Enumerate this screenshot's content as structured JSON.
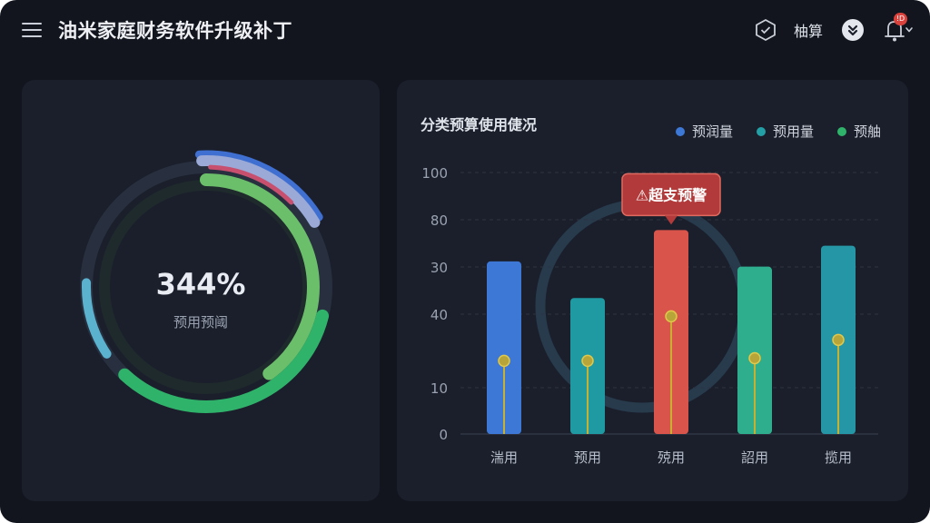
{
  "header": {
    "title": "油米家庭财务软件升级补丁",
    "budget_label": "柚算",
    "notification_badge": "!D"
  },
  "gauge": {
    "value_text": "344%",
    "label": "预用预阈",
    "rings": [
      {
        "color": "#3f6fd1",
        "fraction": 0.17
      },
      {
        "color": "#9aa9d6",
        "fraction": 0.17
      },
      {
        "color": "#c8506e",
        "fraction": 0.12
      },
      {
        "color": "#6bbf6a",
        "fraction": 0.4
      },
      {
        "color": "#2fb36a",
        "fraction": 0.33
      },
      {
        "color": "#5bb2cf",
        "fraction": 0.1
      }
    ]
  },
  "chart_data": {
    "type": "bar",
    "title": "分类预算使用倢况",
    "legend": [
      {
        "label": "预润量",
        "color": "#3d78d6"
      },
      {
        "label": "预用量",
        "color": "#23a0a6"
      },
      {
        "label": "预舳",
        "color": "#2fb36a"
      }
    ],
    "y_ticks": [
      "100",
      "80",
      "30",
      "40",
      "10",
      "0"
    ],
    "categories": [
      "湍用",
      "预用",
      "殑用",
      "詔用",
      "揽用"
    ],
    "values": [
      66,
      52,
      78,
      64,
      72
    ],
    "bar_colors": [
      "#3d78d6",
      "#1f9aa3",
      "#d9544a",
      "#2fae8e",
      "#2596a6"
    ],
    "markers": [
      28,
      28,
      45,
      29,
      36
    ],
    "grid": true,
    "alert": {
      "label": "⚠超支预警",
      "category_index": 2
    }
  }
}
